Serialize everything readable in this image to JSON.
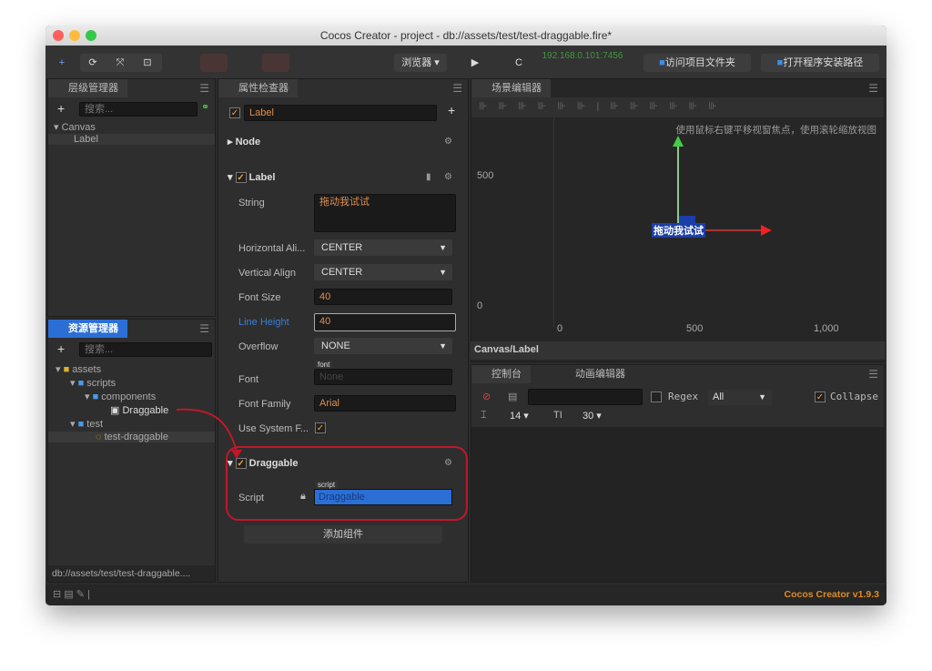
{
  "window": {
    "title": "Cocos Creator - project - db://assets/test/test-draggable.fire*"
  },
  "toolbar": {
    "add": "+",
    "refresh": "⟳",
    "scale": "⤧",
    "rect": "⊡",
    "preview_select": "浏览器",
    "play": "▶",
    "reload": "C",
    "ip": "192.168.0.101:7456",
    "open_project": "访问项目文件夹",
    "open_install": "打开程序安装路径"
  },
  "hierarchy": {
    "title": "层级管理器",
    "search_placeholder": "搜索...",
    "nodes": [
      "Canvas",
      "Label"
    ]
  },
  "assets": {
    "title": "资源管理器",
    "search_placeholder": "搜索...",
    "tree": [
      "assets",
      "scripts",
      "components",
      "Draggable",
      "test",
      "test-draggable"
    ],
    "status_path": "db://assets/test/test-draggable...."
  },
  "inspector": {
    "title": "属性检查器",
    "node_name": "Label",
    "node_section": "Node",
    "label_section": "Label",
    "fields": {
      "string_label": "String",
      "string_value": "拖动我试试",
      "halign_label": "Horizontal Ali...",
      "halign_value": "CENTER",
      "valign_label": "Vertical Align",
      "valign_value": "CENTER",
      "fontsize_label": "Font Size",
      "fontsize_value": "40",
      "lineheight_label": "Line Height",
      "lineheight_value": "40",
      "overflow_label": "Overflow",
      "overflow_value": "NONE",
      "font_label": "Font",
      "font_tag": "font",
      "font_value": "None",
      "fontfamily_label": "Font Family",
      "fontfamily_value": "Arial",
      "usesys_label": "Use System F..."
    },
    "draggable_section": "Draggable",
    "script_label": "Script",
    "script_tag": "script",
    "script_value": "Draggable",
    "add_component": "添加组件"
  },
  "scene": {
    "title": "场景编辑器",
    "hint": "使用鼠标右键平移视窗焦点，使用滚轮缩放视图",
    "y_ticks": [
      "500",
      "0"
    ],
    "x_ticks": [
      "0",
      "500",
      "1,000"
    ],
    "node_text": "拖动我试试",
    "path": "Canvas/Label"
  },
  "console": {
    "tab": "控制台",
    "anim_tab": "动画编辑器",
    "regex": "Regex",
    "filter": "All",
    "collapse": "Collapse",
    "font_size": "14",
    "line_height": "30"
  },
  "footer": {
    "version": "Cocos Creator v1.9.3"
  },
  "colors": {
    "accent": "#f0a030",
    "selection": "#2b6fd6",
    "highlight_ring": "#c0182a"
  }
}
